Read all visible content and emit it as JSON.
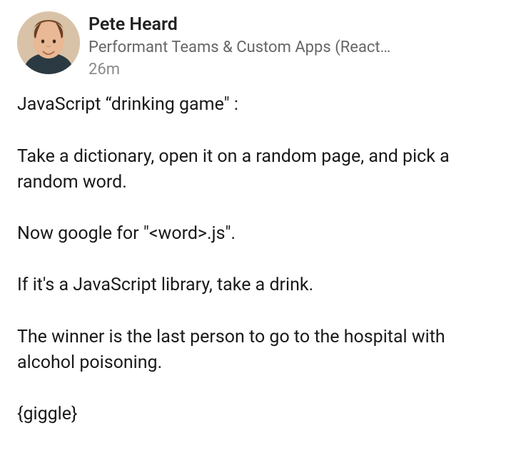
{
  "post": {
    "author": {
      "name": "Pete Heard",
      "headline": "Performant Teams & Custom Apps (React…"
    },
    "time": "26m",
    "body": {
      "p1": "JavaScript “drinking game\" :",
      "p2": "Take a dictionary, open it on a random page, and pick a random word.",
      "p3": "Now google for \"<word>.js\".",
      "p4": "If it's a JavaScript library, take a drink.",
      "p5": "The winner is the last person to go to the hospital with alcohol poisoning.",
      "p6": "{giggle}"
    }
  }
}
